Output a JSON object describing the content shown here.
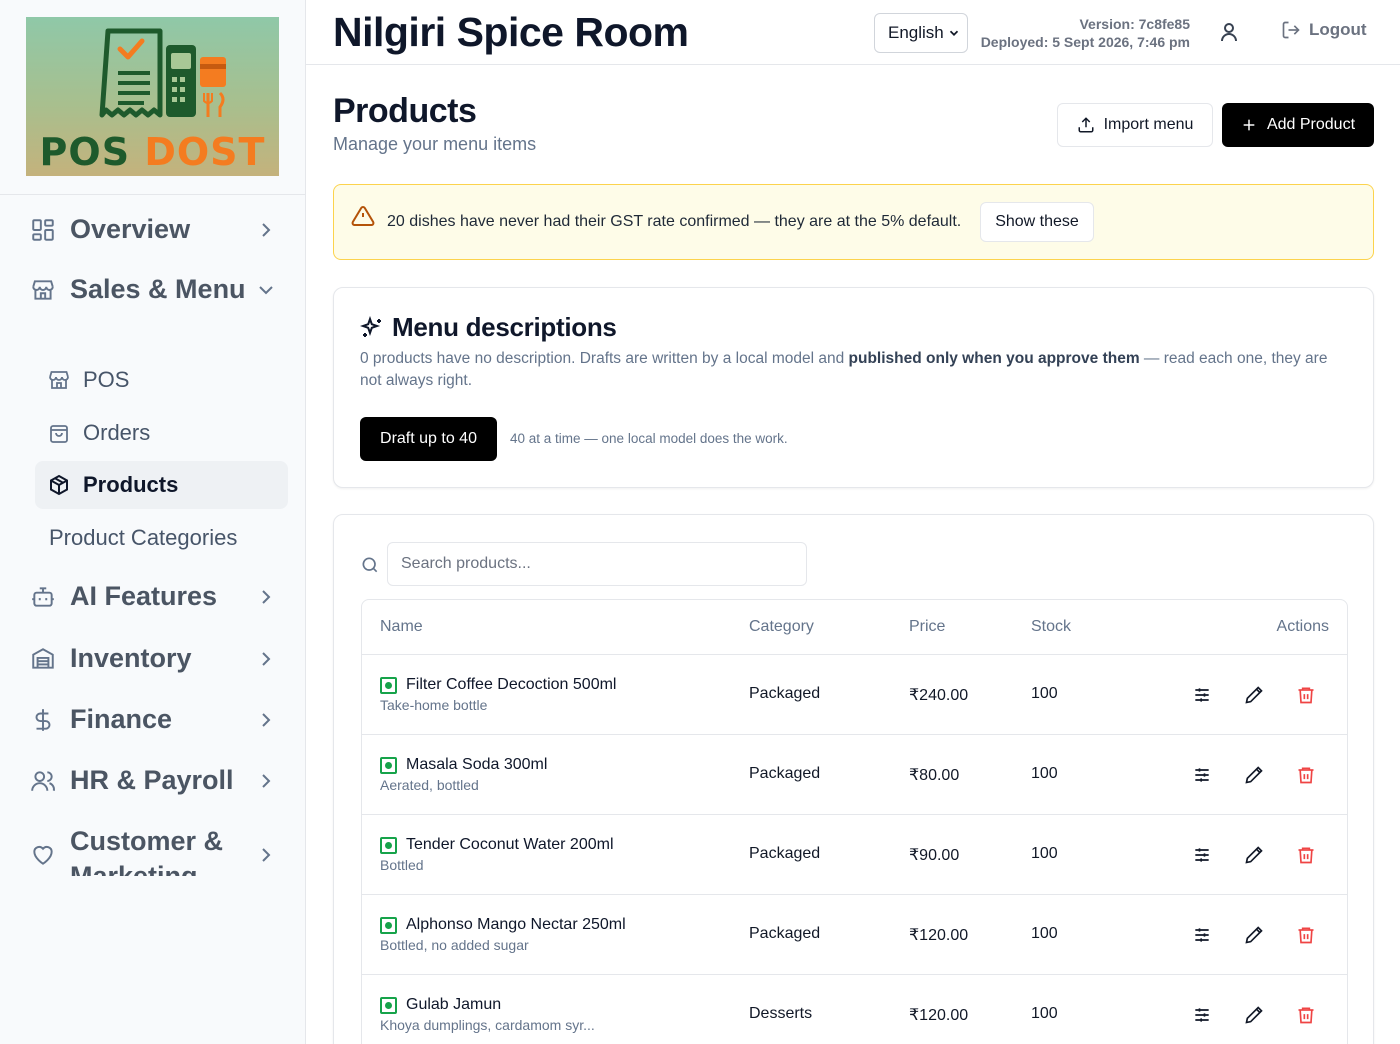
{
  "logo": {
    "word1": "POS",
    "word2": "DOST"
  },
  "sidebar": {
    "items": [
      {
        "label": "Overview",
        "icon": "layout-grid-icon"
      },
      {
        "label": "Sales & Menu",
        "icon": "store-icon"
      },
      {
        "label": "AI Features",
        "icon": "bot-icon"
      },
      {
        "label": "Inventory",
        "icon": "warehouse-icon"
      },
      {
        "label": "Finance",
        "icon": "dollar-sign-icon"
      },
      {
        "label": "HR & Payroll",
        "icon": "users-icon"
      },
      {
        "label": "Customer & Marketing",
        "icon": "heart-icon"
      }
    ],
    "sub_items": [
      {
        "label": "POS",
        "icon": "store-icon"
      },
      {
        "label": "Orders",
        "icon": "shopping-bag-icon"
      },
      {
        "label": "Products",
        "icon": "package-icon",
        "active": true
      },
      {
        "label": "Product Categories"
      }
    ]
  },
  "header": {
    "title": "Nilgiri Spice Room",
    "language": "English",
    "version": "Version: 7c8fe85",
    "deployed": "Deployed: 5 Sept 2026, 7:46 pm",
    "logout_label": "Logout"
  },
  "page": {
    "title": "Products",
    "subtitle": "Manage your menu items",
    "import_label": "Import menu",
    "add_label": "Add Product"
  },
  "alert": {
    "text": "20 dishes have never had their GST rate confirmed — they are at the 5% default.",
    "button": "Show these"
  },
  "descriptions": {
    "title": "Menu descriptions",
    "text_before": "0 products have no description. Drafts are written by a local model and ",
    "text_bold": "published only when you approve them",
    "text_after": " — read each one, they are not always right.",
    "button": "Draft up to 40",
    "note": "40 at a time — one local model does the work."
  },
  "products": {
    "search_placeholder": "Search products...",
    "columns": {
      "name": "Name",
      "category": "Category",
      "price": "Price",
      "stock": "Stock",
      "actions": "Actions"
    },
    "rows": [
      {
        "name": "Filter Coffee Decoction 500ml",
        "desc": "Take-home bottle",
        "category": "Packaged",
        "price": "₹240.00",
        "stock": "100"
      },
      {
        "name": "Masala Soda 300ml",
        "desc": "Aerated, bottled",
        "category": "Packaged",
        "price": "₹80.00",
        "stock": "100"
      },
      {
        "name": "Tender Coconut Water 200ml",
        "desc": "Bottled",
        "category": "Packaged",
        "price": "₹90.00",
        "stock": "100"
      },
      {
        "name": "Alphonso Mango Nectar 250ml",
        "desc": "Bottled, no added sugar",
        "category": "Packaged",
        "price": "₹120.00",
        "stock": "100"
      },
      {
        "name": "Gulab Jamun",
        "desc": "Khoya dumplings, cardamom syr...",
        "category": "Desserts",
        "price": "₹120.00",
        "stock": "100"
      }
    ]
  },
  "colors": {
    "primary": "#000000",
    "alert_bg": "#fefce8",
    "alert_border": "#fcd34d",
    "veg": "#16a34a",
    "delete": "#ef4444"
  }
}
